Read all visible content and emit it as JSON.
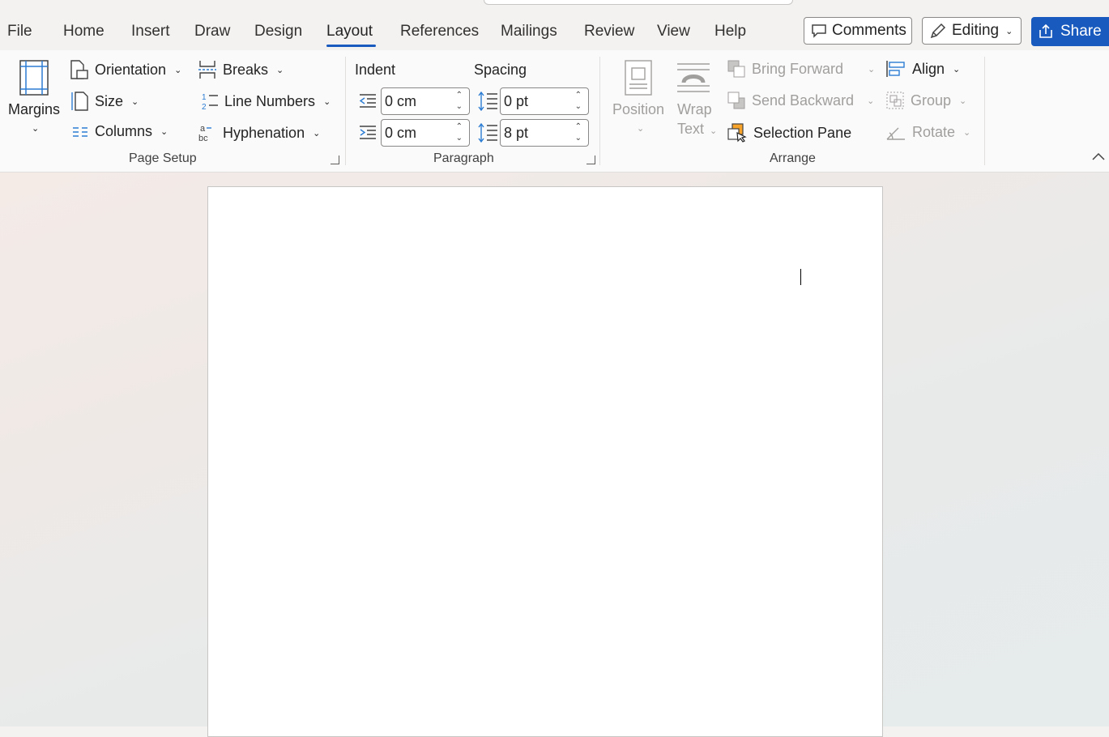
{
  "tabs": [
    {
      "label": "File"
    },
    {
      "label": "Home"
    },
    {
      "label": "Insert"
    },
    {
      "label": "Draw"
    },
    {
      "label": "Design"
    },
    {
      "label": "Layout"
    },
    {
      "label": "References"
    },
    {
      "label": "Mailings"
    },
    {
      "label": "Review"
    },
    {
      "label": "View"
    },
    {
      "label": "Help"
    }
  ],
  "active_tab": "Layout",
  "header": {
    "comments_label": "Comments",
    "editing_label": "Editing",
    "share_label": "Share"
  },
  "page_setup": {
    "margins_label": "Margins",
    "orientation_label": "Orientation",
    "size_label": "Size",
    "columns_label": "Columns",
    "breaks_label": "Breaks",
    "line_numbers_label": "Line Numbers",
    "hyphenation_label": "Hyphenation",
    "group_label": "Page Setup"
  },
  "paragraph": {
    "indent_label": "Indent",
    "spacing_label": "Spacing",
    "indent_left": "0 cm",
    "indent_right": "0 cm",
    "spacing_before": "0 pt",
    "spacing_after": "8 pt",
    "group_label": "Paragraph"
  },
  "arrange": {
    "position_label": "Position",
    "wrap_text_line1": "Wrap",
    "wrap_text_line2": "Text",
    "bring_forward_label": "Bring Forward",
    "send_backward_label": "Send Backward",
    "selection_pane_label": "Selection Pane",
    "align_label": "Align",
    "group_btn_label": "Group",
    "rotate_label": "Rotate",
    "group_label": "Arrange"
  },
  "colors": {
    "accent": "#185abd",
    "text": "#242424",
    "disabled": "#a19f9d",
    "icon_blue": "#2b7cd3",
    "pane_orange": "#f7a229"
  },
  "icons": [
    "margins-icon",
    "orientation-icon",
    "size-icon",
    "columns-icon",
    "breaks-icon",
    "line-numbers-icon",
    "hyphenation-icon",
    "indent-left-icon",
    "indent-right-icon",
    "spacing-before-icon",
    "spacing-after-icon",
    "position-icon",
    "wrap-text-icon",
    "bring-forward-icon",
    "send-backward-icon",
    "selection-pane-icon",
    "align-icon",
    "group-icon",
    "rotate-icon",
    "comment-icon",
    "pen-icon",
    "share-icon",
    "collapse-ribbon-icon"
  ]
}
